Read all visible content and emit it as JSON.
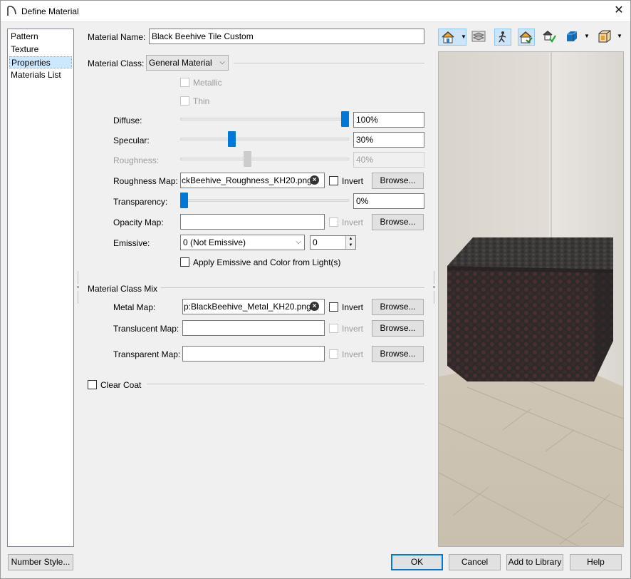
{
  "window": {
    "title": "Define Material"
  },
  "nav": {
    "items": [
      {
        "label": "Pattern"
      },
      {
        "label": "Texture"
      },
      {
        "label": "Properties"
      },
      {
        "label": "Materials List"
      }
    ]
  },
  "material_name": {
    "label": "Material Name:",
    "value": "Black Beehive Tile Custom"
  },
  "material_class": {
    "label": "Material Class:",
    "value": "General Material"
  },
  "metallic": {
    "label": "Metallic"
  },
  "thin": {
    "label": "Thin"
  },
  "diffuse": {
    "label": "Diffuse:",
    "value": "100%",
    "level": 1.0
  },
  "specular": {
    "label": "Specular:",
    "value": "30%",
    "level": 0.3
  },
  "roughness": {
    "label": "Roughness:",
    "value": "40%",
    "level": 0.4
  },
  "roughness_map": {
    "label": "Roughness Map:",
    "value": "ckBeehive_Roughness_KH20.png",
    "invert_label": "Invert",
    "browse_label": "Browse..."
  },
  "transparency": {
    "label": "Transparency:",
    "value": "0%",
    "level": 0.0
  },
  "opacity_map": {
    "label": "Opacity Map:",
    "value": "",
    "invert_label": "Invert",
    "browse_label": "Browse..."
  },
  "emissive": {
    "label": "Emissive:",
    "value": "0 (Not Emissive)",
    "spin_value": "0"
  },
  "apply_emissive": {
    "label": "Apply Emissive and Color from Light(s)"
  },
  "mix": {
    "heading": "Material Class Mix"
  },
  "metal_map": {
    "label": "Metal Map:",
    "value": "p:BlackBeehive_Metal_KH20.png",
    "invert_label": "Invert",
    "browse_label": "Browse..."
  },
  "translucent_map": {
    "label": "Translucent Map:",
    "value": "",
    "invert_label": "Invert",
    "browse_label": "Browse..."
  },
  "transparent_map": {
    "label": "Transparent Map:",
    "value": "",
    "invert_label": "Invert",
    "browse_label": "Browse..."
  },
  "clear_coat": {
    "label": "Clear Coat"
  },
  "footer": {
    "number_style": "Number Style...",
    "ok": "OK",
    "cancel": "Cancel",
    "add_to_library": "Add to Library",
    "help": "Help"
  },
  "colors": {
    "accent": "#0078d7",
    "selected_bg": "#cce8ff"
  },
  "icons": [
    "app-icon",
    "close-icon",
    "house-view-icon",
    "layers-icon",
    "walk-icon",
    "house-check-icon",
    "library-check-icon",
    "cube-icon",
    "box-icon"
  ]
}
